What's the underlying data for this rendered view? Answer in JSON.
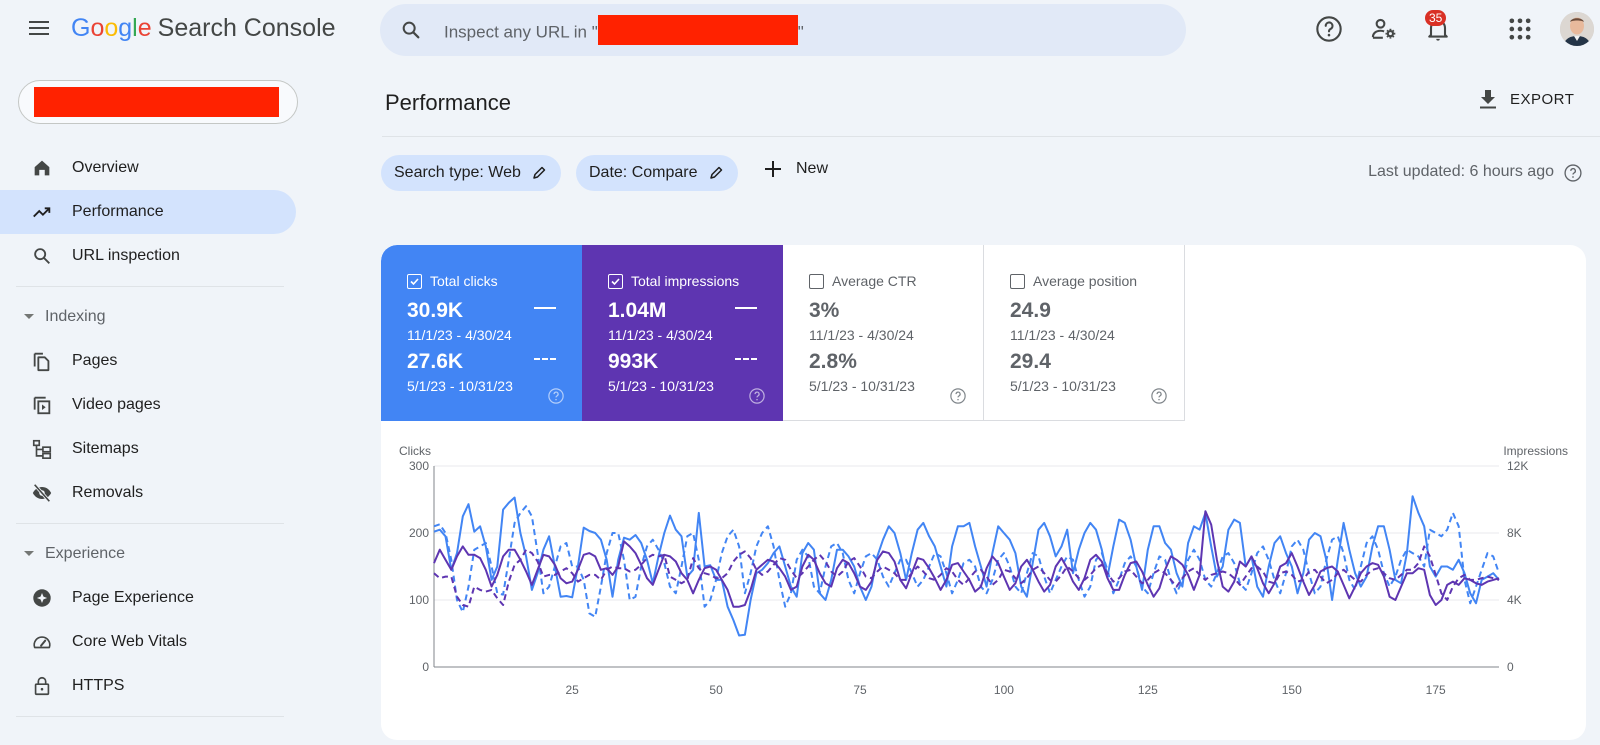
{
  "app": {
    "logo_letters": [
      "G",
      "o",
      "o",
      "g",
      "l",
      "e"
    ],
    "product_name": "Search Console"
  },
  "search": {
    "placeholder_prefix": "Inspect any URL in \"",
    "placeholder_suffix": "\""
  },
  "header_icons": {
    "notifications_count": "35"
  },
  "sidebar": {
    "items": [
      {
        "label": "Overview",
        "icon": "home-icon"
      },
      {
        "label": "Performance",
        "icon": "trending-up-icon",
        "active": true
      },
      {
        "label": "URL inspection",
        "icon": "search-icon"
      }
    ],
    "sections": [
      {
        "label": "Indexing",
        "items": [
          {
            "label": "Pages",
            "icon": "pages-icon"
          },
          {
            "label": "Video pages",
            "icon": "video-pages-icon"
          },
          {
            "label": "Sitemaps",
            "icon": "sitemap-icon"
          },
          {
            "label": "Removals",
            "icon": "visibility-off-icon"
          }
        ]
      },
      {
        "label": "Experience",
        "items": [
          {
            "label": "Page Experience",
            "icon": "page-experience-icon"
          },
          {
            "label": "Core Web Vitals",
            "icon": "speed-gauge-icon"
          },
          {
            "label": "HTTPS",
            "icon": "lock-icon"
          }
        ]
      }
    ]
  },
  "main": {
    "title": "Performance",
    "export_label": "EXPORT",
    "filters": [
      {
        "label": "Search type: Web"
      },
      {
        "label": "Date: Compare"
      }
    ],
    "new_label": "New",
    "last_updated": "Last updated: 6 hours ago"
  },
  "metrics": [
    {
      "title": "Total clicks",
      "checked": true,
      "current_value": "30.9K",
      "current_range": "11/1/23 - 4/30/24",
      "previous_value": "27.6K",
      "previous_range": "5/1/23 - 10/31/23",
      "color": "#4285f4"
    },
    {
      "title": "Total impressions",
      "checked": true,
      "current_value": "1.04M",
      "current_range": "11/1/23 - 4/30/24",
      "previous_value": "993K",
      "previous_range": "5/1/23 - 10/31/23",
      "color": "#5e35b1"
    },
    {
      "title": "Average CTR",
      "checked": false,
      "current_value": "3%",
      "current_range": "11/1/23 - 4/30/24",
      "previous_value": "2.8%",
      "previous_range": "5/1/23 - 10/31/23"
    },
    {
      "title": "Average position",
      "checked": false,
      "current_value": "24.9",
      "current_range": "11/1/23 - 4/30/24",
      "previous_value": "29.4",
      "previous_range": "5/1/23 - 10/31/23"
    }
  ],
  "chart_data": {
    "type": "line",
    "title": "",
    "ylabel": "Clicks",
    "y2label": "Impressions",
    "ylim": [
      0,
      300
    ],
    "y2lim": [
      0,
      12000
    ],
    "yticks": [
      "0",
      "100",
      "200",
      "300"
    ],
    "y2ticks": [
      "0",
      "4K",
      "8K",
      "12K"
    ],
    "xlim": [
      1,
      186
    ],
    "xticks": [
      "25",
      "50",
      "75",
      "100",
      "125",
      "150",
      "175"
    ],
    "grid": true,
    "legend": "none",
    "series": [
      {
        "name": "Clicks (11/1/23 - 4/30/24)",
        "axis": "left",
        "style": "solid",
        "color": "#4285f4",
        "values": [
          202,
          205,
          195,
          145,
          170,
          225,
          243,
          202,
          210,
          180,
          130,
          150,
          235,
          245,
          253,
          200,
          165,
          115,
          140,
          175,
          195,
          150,
          105,
          106,
          104,
          150,
          208,
          203,
          200,
          190,
          160,
          105,
          160,
          193,
          190,
          197,
          185,
          160,
          125,
          165,
          200,
          226,
          205,
          195,
          135,
          145,
          230,
          150,
          152,
          130,
          130,
          90,
          70,
          47,
          48,
          100,
          140,
          145,
          155,
          170,
          180,
          150,
          120,
          105,
          170,
          185,
          175,
          110,
          100,
          130,
          175,
          175,
          165,
          150,
          120,
          100,
          120,
          165,
          190,
          210,
          200,
          170,
          130,
          170,
          205,
          215,
          195,
          180,
          150,
          120,
          180,
          210,
          210,
          215,
          180,
          150,
          120,
          170,
          210,
          200,
          190,
          170,
          120,
          105,
          155,
          205,
          215,
          195,
          165,
          180,
          205,
          140,
          175,
          200,
          215,
          205,
          175,
          135,
          180,
          220,
          215,
          190,
          150,
          115,
          175,
          210,
          210,
          185,
          175,
          140,
          120,
          185,
          210,
          205,
          230,
          180,
          135,
          150,
          205,
          220,
          215,
          150,
          165,
          120,
          105,
          150,
          185,
          195,
          170,
          150,
          110,
          140,
          190,
          200,
          195,
          160,
          100,
          160,
          215,
          175,
          140,
          120,
          135,
          180,
          210,
          210,
          175,
          130,
          125,
          170,
          255,
          230,
          210,
          150,
          135,
          150,
          150,
          145,
          160,
          140,
          110,
          95,
          130,
          135,
          140,
          130
        ]
      },
      {
        "name": "Clicks (5/1/23 - 10/31/23)",
        "axis": "left",
        "style": "dashed",
        "color": "#4285f4",
        "values": [
          210,
          213,
          200,
          160,
          100,
          82,
          120,
          175,
          180,
          185,
          150,
          110,
          108,
          160,
          215,
          230,
          240,
          225,
          170,
          110,
          120,
          150,
          180,
          185,
          150,
          150,
          130,
          80,
          75,
          120,
          170,
          200,
          200,
          160,
          100,
          105,
          150,
          180,
          190,
          175,
          155,
          120,
          110,
          150,
          195,
          200,
          160,
          90,
          100,
          130,
          170,
          195,
          205,
          180,
          110,
          140,
          180,
          200,
          210,
          180,
          130,
          90,
          110,
          160,
          175,
          165,
          120,
          110,
          150,
          180,
          185,
          170,
          130,
          110,
          140,
          165,
          170,
          160,
          135,
          120,
          140,
          160,
          160,
          140,
          120,
          130,
          150,
          170,
          165,
          140,
          110,
          130,
          155,
          160,
          150,
          120,
          110,
          130,
          160,
          170,
          150,
          120,
          110,
          140,
          170,
          165,
          135,
          110,
          130,
          150,
          165,
          160,
          130,
          105,
          120,
          160,
          170,
          145,
          110,
          130,
          155,
          165,
          150,
          120,
          110,
          140,
          165,
          160,
          130,
          110,
          130,
          160,
          175,
          160,
          130,
          120,
          140,
          165,
          170,
          155,
          125,
          115,
          140,
          170,
          180,
          160,
          130,
          110,
          140,
          180,
          190,
          175,
          140,
          110,
          120,
          160,
          190,
          195,
          170,
          130,
          115,
          150,
          185,
          195,
          175,
          140,
          120,
          135,
          160,
          175,
          170,
          165,
          150,
          205,
          200,
          195,
          205,
          230,
          210,
          130,
          95,
          120,
          145,
          170,
          165,
          140
        ]
      },
      {
        "name": "Impressions (11/1/23 - 4/30/24)",
        "axis": "right",
        "style": "solid",
        "color": "#5e35b1",
        "values": [
          6200,
          7000,
          6400,
          5800,
          6600,
          7200,
          6700,
          6700,
          6500,
          5800,
          4800,
          5500,
          6600,
          7000,
          7000,
          6400,
          5700,
          4900,
          5800,
          6700,
          6600,
          6100,
          5300,
          5000,
          5100,
          5800,
          6700,
          6800,
          6600,
          5800,
          5900,
          5500,
          6000,
          7500,
          7200,
          6800,
          6100,
          5300,
          4900,
          5800,
          6700,
          6600,
          6300,
          5600,
          5200,
          4400,
          5200,
          5900,
          6000,
          5800,
          5200,
          4600,
          3600,
          3600,
          3700,
          4600,
          5800,
          6100,
          6400,
          6300,
          5900,
          5400,
          4600,
          4800,
          6000,
          6700,
          6400,
          5600,
          5000,
          4800,
          5900,
          6400,
          6200,
          5600,
          4800,
          4600,
          5100,
          6400,
          6900,
          6800,
          6300,
          5200,
          4700,
          5600,
          6500,
          6400,
          5900,
          5300,
          4600,
          5200,
          6100,
          6200,
          5700,
          5200,
          4500,
          4800,
          5900,
          6600,
          6200,
          5400,
          4600,
          5000,
          6000,
          6400,
          5800,
          5100,
          4500,
          4900,
          6000,
          6500,
          5900,
          5100,
          4600,
          5300,
          6400,
          6700,
          6300,
          5300,
          4600,
          4600,
          5500,
          6200,
          6300,
          5700,
          4900,
          4200,
          4700,
          5800,
          6600,
          6400,
          6100,
          5500,
          4600,
          5500,
          9300,
          8500,
          6400,
          4800,
          4500,
          5100,
          6300,
          6000,
          6600,
          5900,
          5000,
          4400,
          5000,
          6000,
          6200,
          6800,
          6000,
          5100,
          4300,
          4900,
          5700,
          5900,
          6000,
          5700,
          4900,
          4100,
          4800,
          5600,
          6000,
          6200,
          6100,
          5400,
          4200,
          4000,
          4800,
          5600,
          5600,
          5900,
          5800,
          4300,
          3700,
          4000,
          4900,
          5100,
          4900,
          5300,
          5200,
          5000,
          4900,
          5100,
          5200,
          5300
        ]
      },
      {
        "name": "Impressions (5/1/23 - 10/31/23)",
        "axis": "right",
        "style": "dashed",
        "color": "#5e35b1",
        "values": [
          5600,
          5300,
          5400,
          5400,
          4200,
          3700,
          3600,
          4800,
          4600,
          4500,
          4600,
          4100,
          3700,
          5100,
          6100,
          6400,
          7000,
          6800,
          6300,
          5400,
          5500,
          5500,
          5700,
          5900,
          5600,
          5100,
          5300,
          5500,
          5500,
          5200,
          5800,
          6000,
          5900,
          5900,
          5700,
          5800,
          6100,
          6500,
          6700,
          6600,
          6700,
          5400,
          5200,
          5000,
          5200,
          6500,
          5900,
          5600,
          5500,
          5300,
          5300,
          5600,
          6300,
          6700,
          6900,
          6500,
          5800,
          5500,
          5700,
          6100,
          6500,
          6400,
          5800,
          5300,
          5600,
          6000,
          6400,
          6700,
          6300,
          5700,
          5400,
          5700,
          6300,
          6500,
          6000,
          5400,
          5300,
          5700,
          6000,
          5800,
          5600,
          5200,
          5200,
          5600,
          6000,
          5700,
          5300,
          5200,
          5500,
          5900,
          5700,
          5200,
          4900,
          5300,
          5700,
          5800,
          5400,
          4900,
          5200,
          5800,
          5700,
          5300,
          5000,
          5300,
          5800,
          6000,
          5600,
          5200,
          5100,
          5500,
          6000,
          5700,
          5300,
          5200,
          5500,
          5900,
          6100,
          5600,
          5100,
          5300,
          5700,
          5800,
          5400,
          5000,
          5200,
          5600,
          5800,
          5600,
          5200,
          4800,
          5300,
          5700,
          5900,
          5500,
          5200,
          5500,
          5600,
          5700,
          5600,
          5300,
          4900,
          5400,
          5900,
          6000,
          5700,
          5100,
          5000,
          5600,
          5700,
          5500,
          5100,
          5200,
          5700,
          5800,
          5400,
          5000,
          5200,
          5600,
          5800,
          5500,
          5200,
          5100,
          5500,
          5800,
          5900,
          5600,
          5300,
          5200,
          5500,
          5800,
          5800,
          6200,
          7200,
          6600,
          5500,
          4400,
          4000,
          4800,
          5300,
          5500,
          5200,
          5200,
          5300,
          5400,
          5300,
          5200
        ]
      }
    ]
  }
}
